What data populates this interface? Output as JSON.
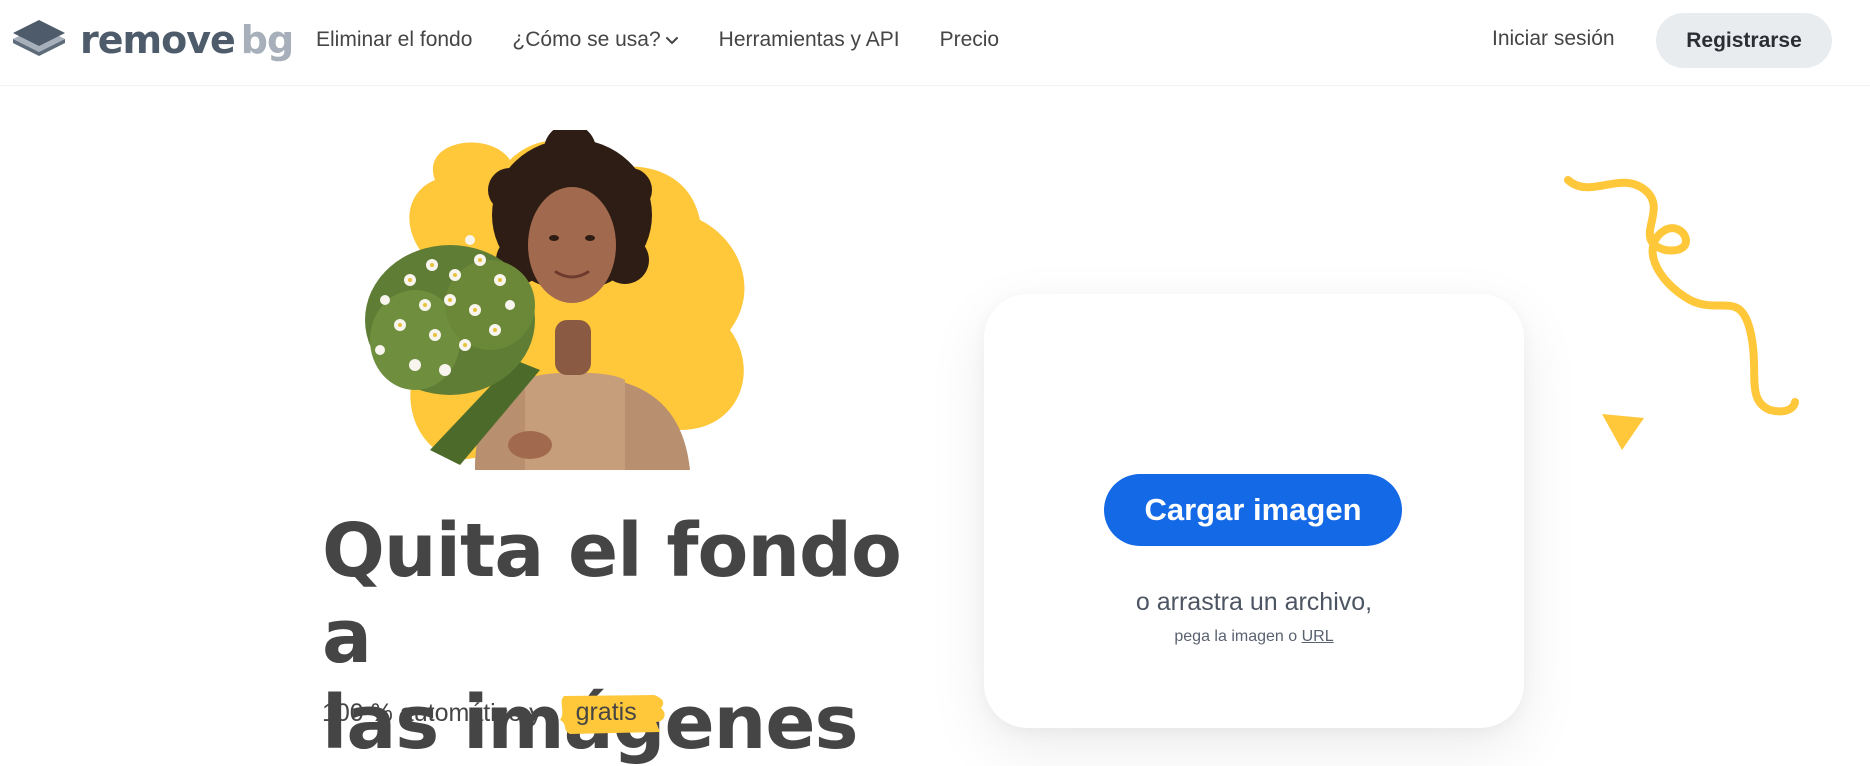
{
  "brand": {
    "logo_remove": "remove",
    "logo_bg": "bg"
  },
  "nav": {
    "items": [
      {
        "label": "Eliminar el fondo"
      },
      {
        "label": "¿Cómo se usa?",
        "has_dropdown": true
      },
      {
        "label": "Herramientas y API"
      },
      {
        "label": "Precio"
      }
    ],
    "login_label": "Iniciar sesión",
    "signup_label": "Registrarse"
  },
  "hero": {
    "title_line1": "Quita el fondo a",
    "title_line2": "las imágenes",
    "subtitle_prefix": "100 % automático y",
    "subtitle_highlight": "gratis"
  },
  "upload": {
    "button_label": "Cargar imagen",
    "drag_text": "o arrastra un archivo,",
    "paste_prefix": "pega la imagen o",
    "url_label": "URL"
  },
  "colors": {
    "accent_blue": "#1469e6",
    "accent_yellow": "#ffc73a",
    "text_dark": "#454545",
    "signup_bg": "#e9ecef"
  },
  "icons": {
    "logo": "layered-diamond-logo",
    "dropdown": "chevron-down-icon"
  }
}
